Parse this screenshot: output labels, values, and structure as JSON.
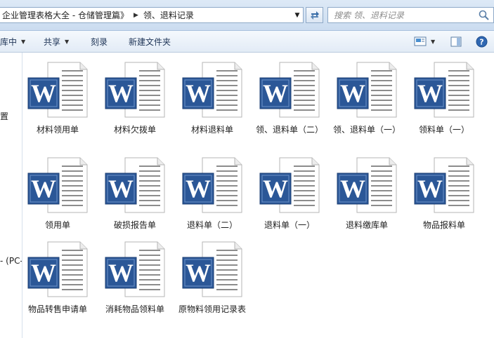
{
  "address": {
    "crumbs": [
      "企业管理表格大全 - 仓储管理篇》",
      "领、退料记录"
    ],
    "separator_glyph": "▶",
    "dropdown_glyph": "▼"
  },
  "search": {
    "placeholder": "搜索 领、退料记录"
  },
  "toolbar": {
    "library_label": "库中",
    "share_label": "共享",
    "burn_label": "刻录",
    "new_folder_label": "新建文件夹",
    "caret_glyph": "▼"
  },
  "navpane": {
    "item1": "置",
    "item2": "(PC-"
  },
  "files": [
    {
      "name": "材料领用单"
    },
    {
      "name": "材料欠拨单"
    },
    {
      "name": "材料退料单"
    },
    {
      "name": "领、退料单（二）"
    },
    {
      "name": "领、退料单（一）"
    },
    {
      "name": "领料单（一）"
    },
    {
      "name": "领用单"
    },
    {
      "name": "破损报告单"
    },
    {
      "name": "退料单（二）"
    },
    {
      "name": "退料单（一）"
    },
    {
      "name": "退料缴库单"
    },
    {
      "name": "物品报料单"
    },
    {
      "name": "物品转售申请单"
    },
    {
      "name": "消耗物品领料单"
    },
    {
      "name": "原物料领用记录表"
    }
  ],
  "icons": {
    "file_type": "word-document-icon",
    "letter": "W"
  },
  "colors": {
    "word_blue": "#2b5797",
    "toolbar_text": "#1e3457"
  }
}
